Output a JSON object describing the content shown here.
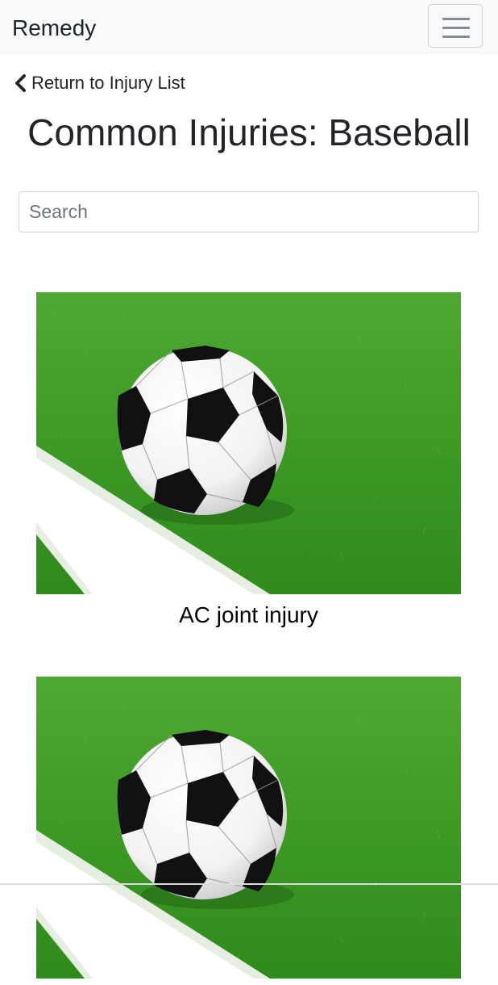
{
  "navbar": {
    "brand": "Remedy",
    "toggle_icon": "hamburger-menu-icon"
  },
  "back_link": {
    "icon": "chevron-left-icon",
    "label": "Return to Injury List"
  },
  "page": {
    "title": "Common Injuries: Baseball"
  },
  "search": {
    "placeholder": "Search",
    "value": ""
  },
  "injuries": [
    {
      "name": "AC joint injury",
      "image": "soccer-ball-on-grass"
    },
    {
      "name": "",
      "image": "soccer-ball-on-grass"
    }
  ],
  "colors": {
    "navbar_bg": "#f8f9fa",
    "grass": "#3f9a25",
    "text": "#212529"
  }
}
